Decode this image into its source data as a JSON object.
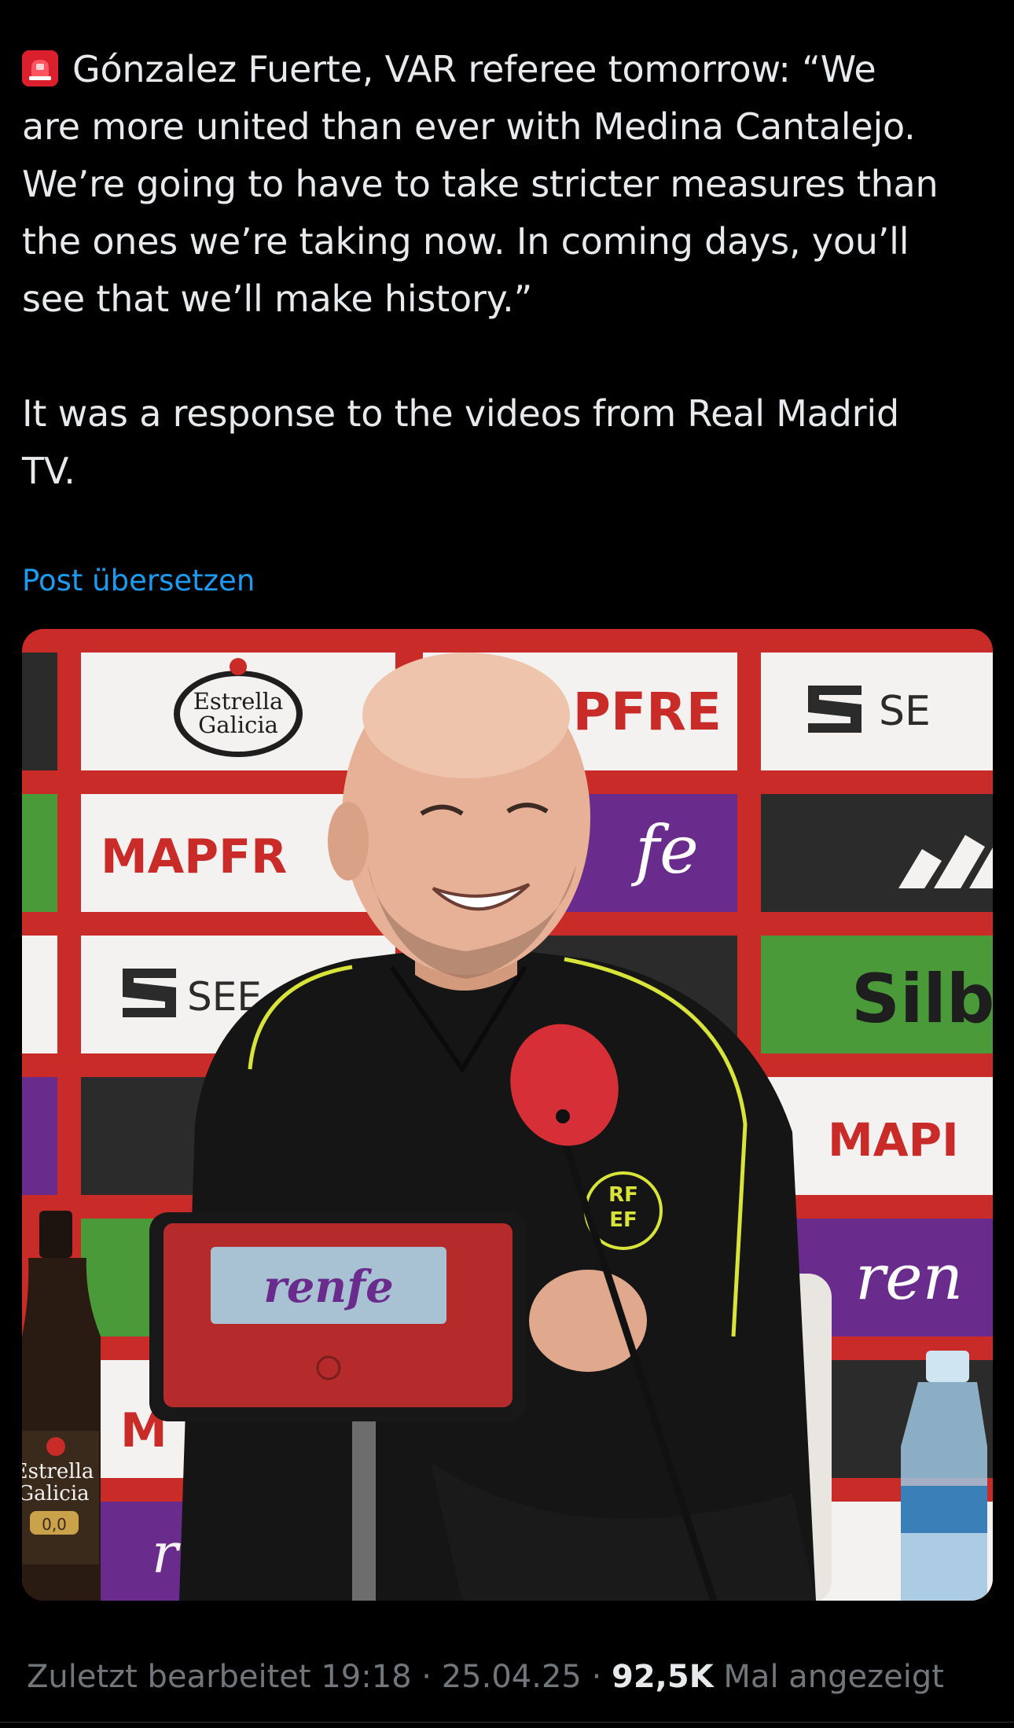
{
  "post": {
    "emoji_icon": "police-car-light-icon",
    "paragraph_1_line_1": "Gónzalez Fuerte, VAR referee tomorrow: “We",
    "paragraph_1_line_2": "are more united than ever with Medina Cantalejo.",
    "paragraph_1_line_3": "We’re going to have to take stricter measures than",
    "paragraph_1_line_4": "the ones we’re taking now. In coming days, you’ll",
    "paragraph_1_line_5": "see that we’ll make history.”",
    "paragraph_2_line_1": "It was a response to the videos from Real Madrid",
    "paragraph_2_line_2": "TV.",
    "translate_label": "Post übersetzen"
  },
  "media": {
    "sponsor_estrella": "Estrella",
    "sponsor_galicia": "Galicia",
    "sponsor_mapfre_a": "PFRE",
    "sponsor_mapfre_b": "MAPFR",
    "sponsor_seat_a": "SE",
    "sponsor_seat_b": "SEE",
    "sponsor_renfe_wall": "fe",
    "sponsor_silb": "Silb",
    "sponsor_mapi": "MAPI",
    "sponsor_ren": "ren",
    "podium_renfe": "renfe",
    "badge_rf": "RF",
    "badge_ef": "EF",
    "bottle_estrella": "Estrella",
    "bottle_galicia": "Galicia",
    "bottle_00": "0,0",
    "bottom_m": "M",
    "hash_c": "#C",
    "colors": {
      "backdrop_red": "#c92b28",
      "panel_white": "#f4f2f0",
      "renfe_purple": "#6a2c8c",
      "seat_dark": "#2b2b2b",
      "silb_green": "#4a9a3a",
      "shirt_black": "#151515",
      "piping_yellow": "#d9e43a"
    }
  },
  "meta": {
    "edited_label": "Zuletzt bearbeitet 19:18 · 25.04.25",
    "separator": " · ",
    "views_count": "92,5K",
    "views_label": "Mal angezeigt"
  },
  "colors": {
    "background": "#000000",
    "text": "#e7e9ea",
    "link": "#1d9bf0",
    "muted": "#71767b"
  }
}
